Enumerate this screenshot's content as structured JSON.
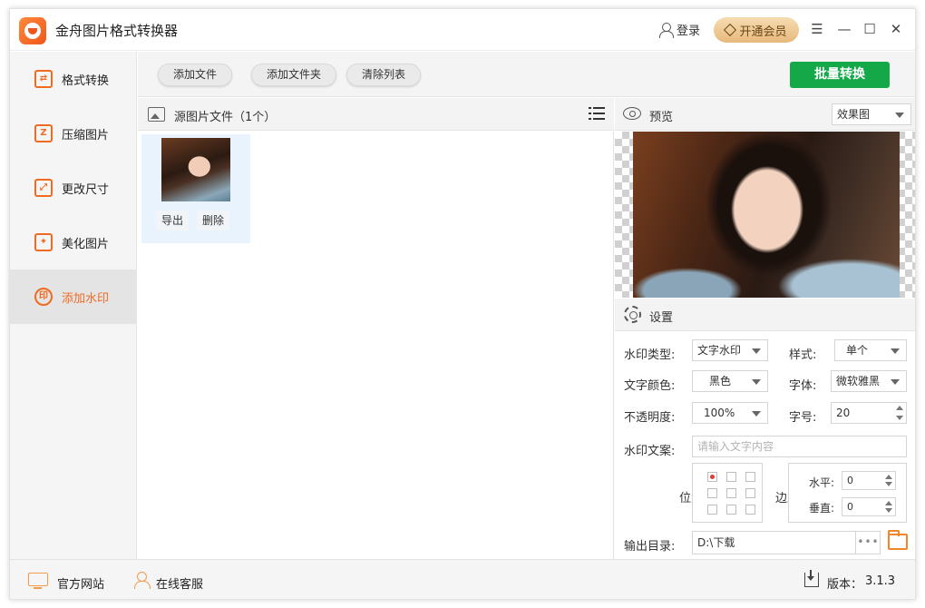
{
  "app": {
    "title": "金舟图片格式转换器",
    "login": "登录",
    "vip": "开通会员"
  },
  "window_controls": {
    "menu": "☰",
    "minimize": "—",
    "maximize": "☐",
    "close": "✕"
  },
  "sidebar": {
    "items": [
      {
        "label": "格式转换",
        "icon": "convert-icon",
        "active": false
      },
      {
        "label": "压缩图片",
        "icon": "compress-icon",
        "active": false
      },
      {
        "label": "更改尺寸",
        "icon": "resize-icon",
        "active": false
      },
      {
        "label": "美化图片",
        "icon": "beautify-icon",
        "active": false
      },
      {
        "label": "添加水印",
        "icon": "watermark-icon",
        "active": true
      }
    ],
    "active_color": "#f06a22"
  },
  "toolbar": {
    "add_file": "添加文件",
    "add_folder": "添加文件夹",
    "clear_list": "清除列表",
    "batch_convert": "批量转换",
    "batch_color": "#14a849"
  },
  "source": {
    "title": "源图片文件（1个）",
    "files": [
      {
        "export": "导出",
        "delete": "删除"
      }
    ]
  },
  "preview": {
    "title": "预览",
    "mode": "效果图"
  },
  "settings": {
    "title": "设置",
    "watermark_type_label": "水印类型:",
    "watermark_type": "文字水印",
    "style_label": "样式:",
    "style": "单个",
    "text_color_label": "文字颜色:",
    "text_color": "黑色",
    "font_label": "字体:",
    "font": "微软雅黑",
    "opacity_label": "不透明度:",
    "opacity": "100%",
    "size_label": "字号:",
    "size": "20",
    "text_label": "水印文案:",
    "text_placeholder": "请输入文字内容",
    "position_label": "位置",
    "margin_label": "边距",
    "horizontal_label": "水平:",
    "horizontal": "0",
    "vertical_label": "垂直:",
    "vertical": "0",
    "output_label": "输出目录:",
    "output_dir": "D:\\下载",
    "dots": "•••"
  },
  "footer": {
    "website": "官方网站",
    "service": "在线客服",
    "version_label": "版本：",
    "version": "3.1.3"
  }
}
